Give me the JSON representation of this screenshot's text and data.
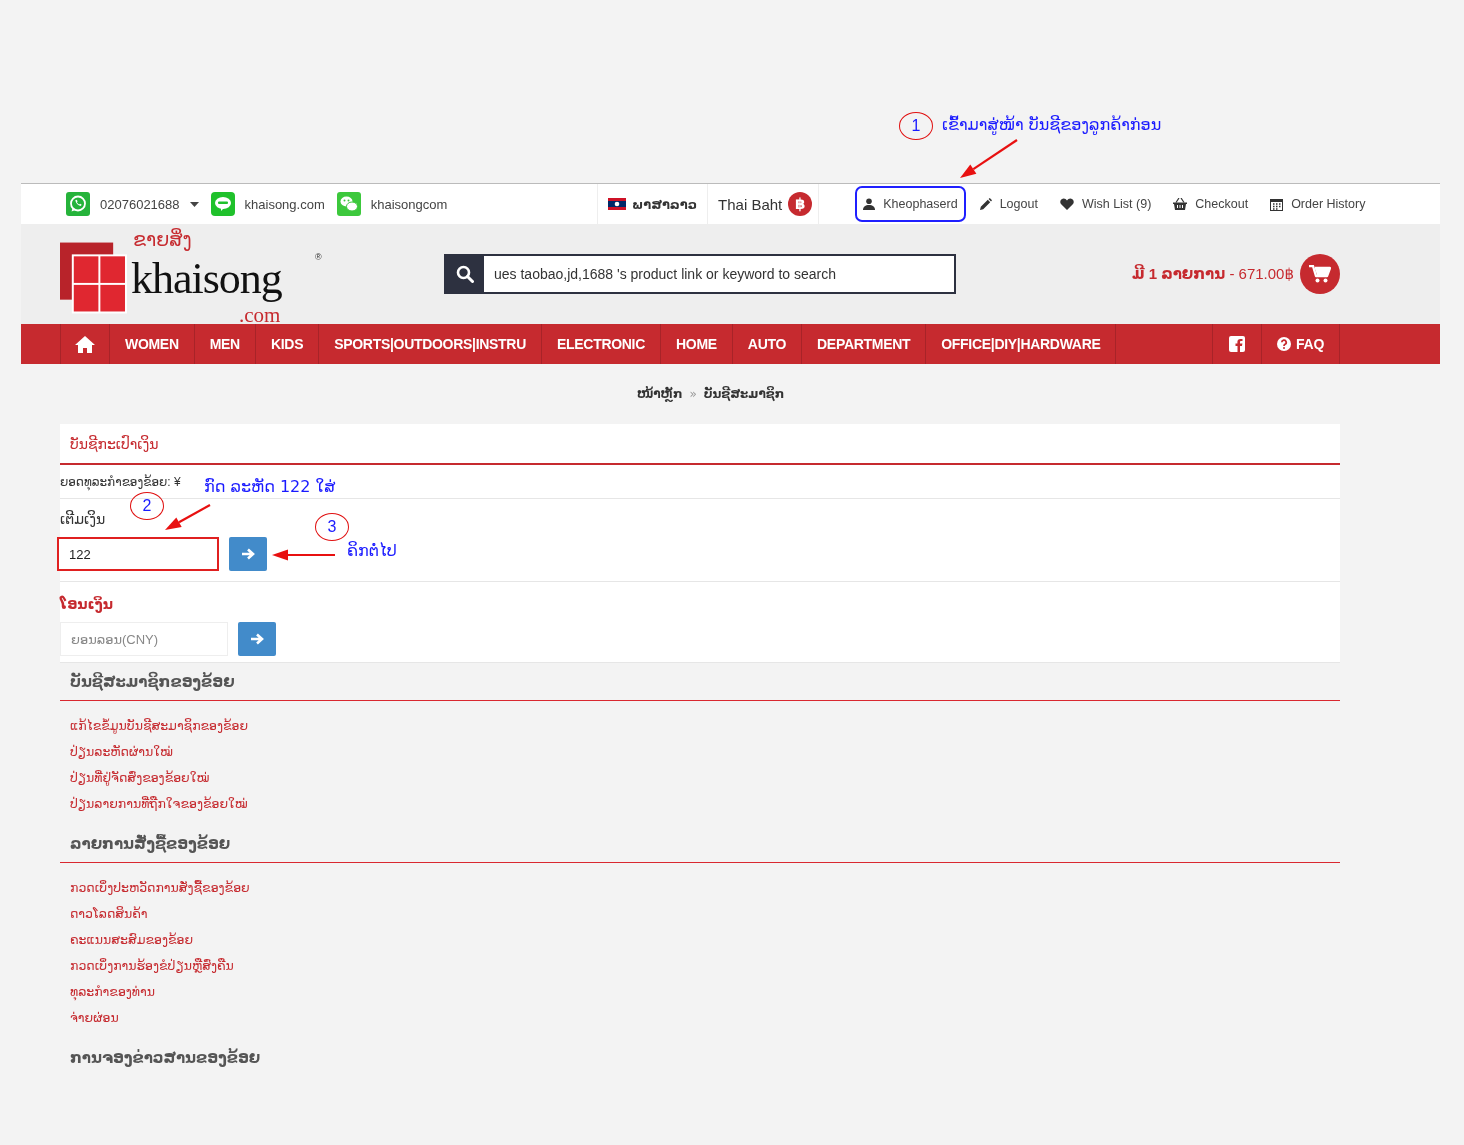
{
  "topbar": {
    "contacts": [
      {
        "kind": "whatsapp",
        "text": "02076021688",
        "dropdown": true
      },
      {
        "kind": "line",
        "text": "khaisong.com",
        "dropdown": false
      },
      {
        "kind": "wechat",
        "text": "khaisongcom",
        "dropdown": false
      }
    ],
    "language": "ພາສາລາວ",
    "currency": "Thai Baht",
    "currency_symbol": "฿",
    "links": [
      {
        "kind": "user",
        "text": "Kheophaserd",
        "highlighted": true
      },
      {
        "kind": "pencil",
        "text": "Logout",
        "highlighted": false
      },
      {
        "kind": "heart",
        "text": "Wish List (9)",
        "highlighted": false
      },
      {
        "kind": "basket",
        "text": "Checkout",
        "highlighted": false
      },
      {
        "kind": "calendar",
        "text": "Order History",
        "highlighted": false
      }
    ]
  },
  "header": {
    "logo": {
      "lao": "ຂາຍສິ່ງ",
      "name": "khaisong",
      "domain": ".com",
      "mark": "®"
    },
    "search": {
      "value": "ues taobao,jd,1688 's product link or keyword to search"
    },
    "cart": {
      "summary": "**ມີ 1 ລາຍການ** - 671.00฿"
    }
  },
  "nav": [
    {
      "kind": "home"
    },
    {
      "kind": "link",
      "label": "WOMEN"
    },
    {
      "kind": "link",
      "label": "MEN"
    },
    {
      "kind": "link",
      "label": "KIDS"
    },
    {
      "kind": "link",
      "label": "SPORTS|OUTDOORS|INSTRU"
    },
    {
      "kind": "link",
      "label": "ELECTRONIC"
    },
    {
      "kind": "link",
      "label": "HOME"
    },
    {
      "kind": "link",
      "label": "AUTO"
    },
    {
      "kind": "link",
      "label": "DEPARTMENT"
    },
    {
      "kind": "link",
      "label": "OFFICE|DIY|HARDWARE"
    },
    {
      "kind": "facebook"
    },
    {
      "kind": "help",
      "label": "FAQ"
    }
  ],
  "breadcrumb": {
    "items": [
      "ໜ້າຫຼັກ",
      "ບັນຊີສະມາຊິກ"
    ],
    "separator": "»"
  },
  "wallet": {
    "title": "ບັນຊີກະເປົາເງິນ",
    "balance": "ຍອດທຸລະກຳຂອງຂ້ອຍ: ¥",
    "topup": {
      "label": "ເຕີມເງິນ",
      "value": "122",
      "highlighted": true
    },
    "transfer": {
      "label": "ໂອນເງິນ",
      "placeholder": "ຍອນລອນ(CNY)",
      "highlighted": false
    }
  },
  "sections": [
    {
      "title": "ບັນຊີສະມາຊິກຂອງຂ້ອຍ",
      "links": [
        "ແກ້ໄຂຂໍ້ມູນບັນຊີສະມາຊິກຂອງຂ້ອຍ",
        "ປ່ຽນລະຫັດຜ່ານໃໝ່",
        "ປ່ຽນທີ່ຢູ່ຈັດສົ່ງຂອງຂ້ອຍໃໝ່",
        "ປ່ຽນລາຍການທີ່ຖືກໃຈຂອງຂ້ອຍໃໝ່"
      ]
    },
    {
      "title": "ລາຍການສັ່ງຊື້ຂອງຂ້ອຍ",
      "links": [
        "ກວດເບິ່ງປະຫວັດການສັ່ງຊື້ຂອງຂ້ອຍ",
        "ດາວໂລດສິນຄ້າ",
        "ຄະແນນສະສົມຂອງຂ້ອຍ",
        "ກວດເບິ່ງການຮ້ອງຂໍປ່ຽນຫຼືສົ່ງຄືນ",
        "ທຸລະກຳຂອງທ່ານ",
        "ຈ່າຍຜ່ອນ"
      ]
    },
    {
      "title": "ການຈອງຂ່າວສານຂອງຂ້ອຍ"
    }
  ],
  "annotations": [
    {
      "number": "1",
      "text": "ເຂົ້າມາສູ່ໜ້າ ບັນຊີຂອງລູກຄ້າກ່ອນ"
    },
    {
      "number": "2",
      "text": "ກົດ ລະຫັດ 122 ໃສ່"
    },
    {
      "number": "3",
      "text": "ຄິກຕໍ່ໄປ"
    }
  ]
}
